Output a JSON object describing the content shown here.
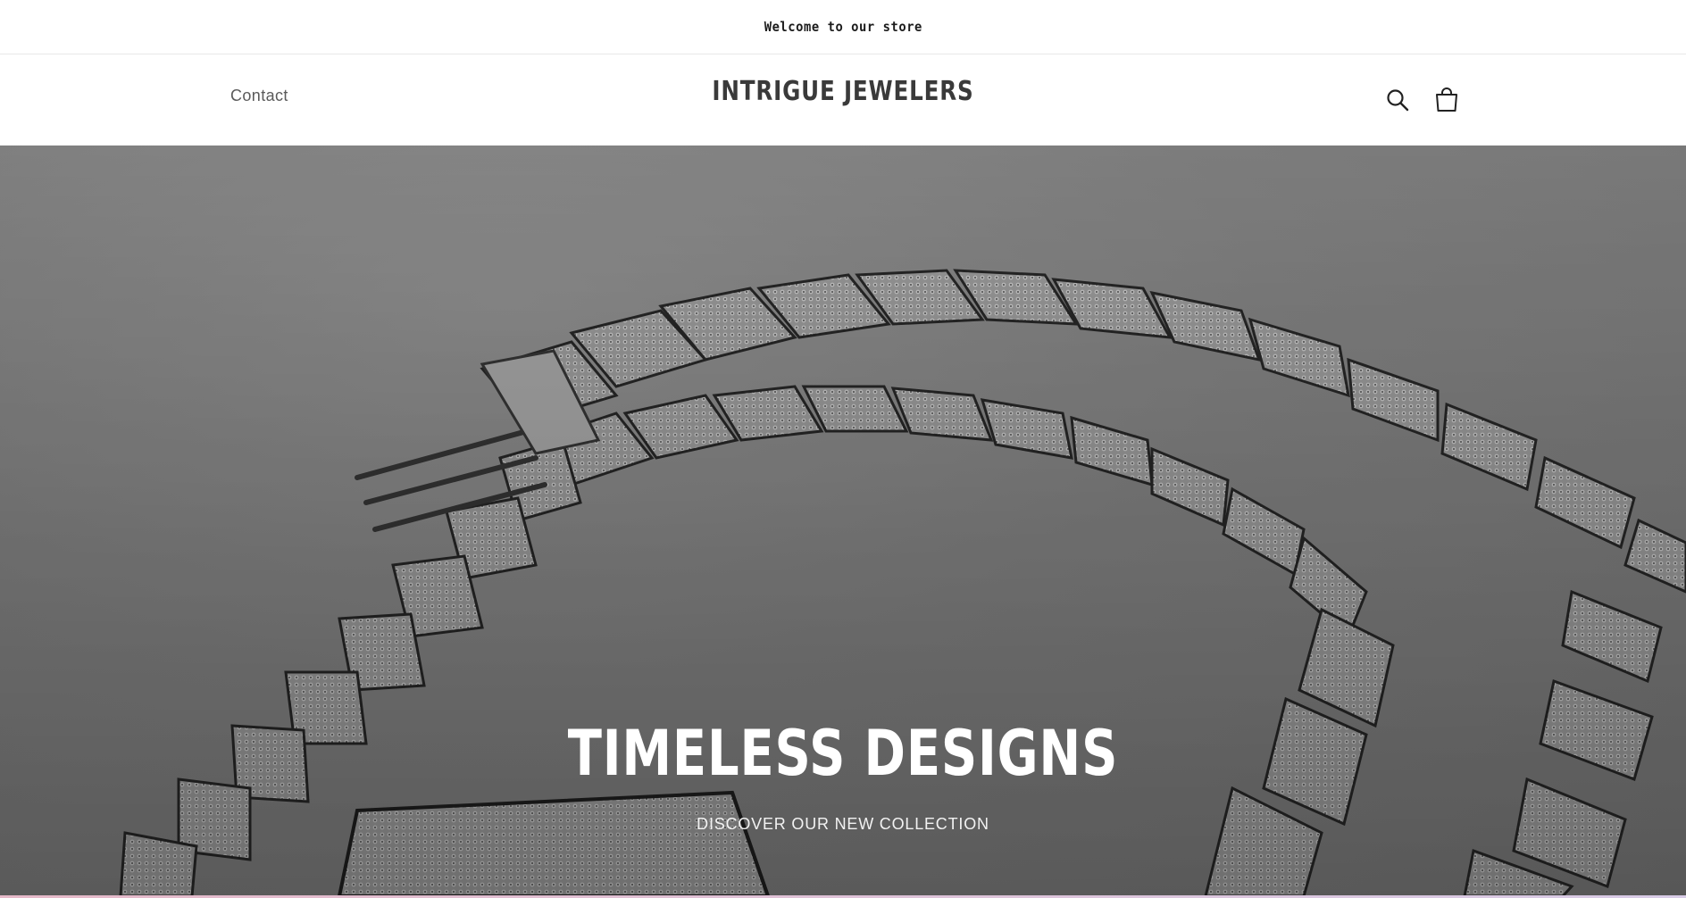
{
  "announcement": {
    "text": "Welcome to our store"
  },
  "header": {
    "nav_contact": "Contact",
    "brand": "INTRIGUE JEWELERS",
    "icons": [
      "search-icon",
      "cart-icon"
    ]
  },
  "hero": {
    "title": "TIMELESS DESIGNS",
    "subtitle": "DISCOVER OUR NEW COLLECTION"
  },
  "colors": {
    "text_dark": "#1c1c1c",
    "brand_text": "#3a3a3a",
    "hero_bg": "#8e8e8e",
    "hero_text": "#ffffff"
  }
}
